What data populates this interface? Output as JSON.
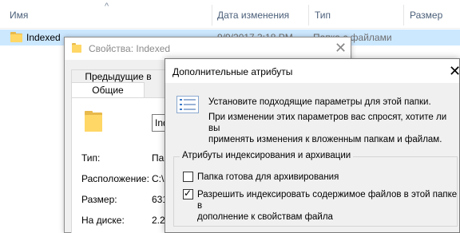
{
  "explorer": {
    "columns": {
      "name": "Имя",
      "date": "Дата изменения",
      "type": "Тип",
      "size": "Размер"
    },
    "row": {
      "name": "Indexed",
      "date": "9/9/2017 3:18 PM",
      "type": "Папка с файлами"
    }
  },
  "properties_dialog": {
    "title": "Свойства: Indexed",
    "tab_previous": "Предыдущие в",
    "tab_general": "Общие",
    "name_value": "Indexed",
    "fields": {
      "type_label": "Тип:",
      "type_value": "Папка с файлами",
      "location_label": "Расположение:",
      "location_value": "C:\\",
      "size_label": "Размер:",
      "size_value": "631",
      "disk_label": "На диске:",
      "disk_value": "2.20"
    }
  },
  "advanced_dialog": {
    "title": "Дополнительные атрибуты",
    "intro": "Установите подходящие параметры для этой папки.",
    "description_line1": "При изменении этих параметров вас спросят, хотите ли вы",
    "description_line2": "применять изменения к вложенным папкам и файлам.",
    "group_title": "Атрибуты индексирования и архивации",
    "archive_label": "Папка готова для архивирования",
    "archive_checked": false,
    "index_label_line1": "Разрешить индексировать содержимое файлов в этой папке в",
    "index_label_line2": "дополнение к свойствам файла",
    "index_checked": true,
    "check_mark": "✓"
  }
}
